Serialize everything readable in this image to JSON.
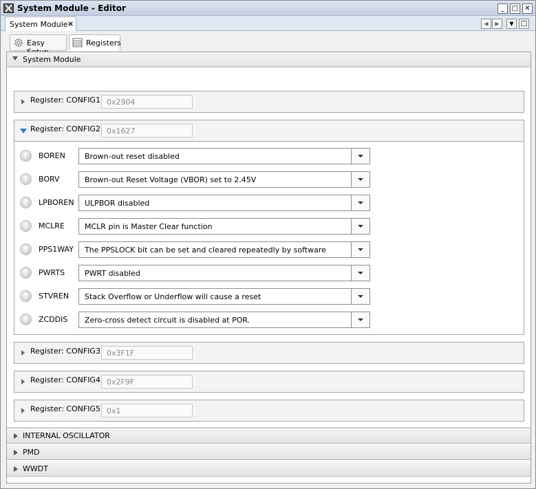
{
  "window": {
    "title": "System Module - Editor",
    "controls": {
      "minimize": "_",
      "maximize": "□",
      "close": "✕"
    }
  },
  "editor_tab": {
    "label": "System Module",
    "close": "×"
  },
  "nav": {
    "prev": "◀",
    "next": "▶",
    "menu": "▼",
    "restore": "□"
  },
  "subtabs": [
    {
      "label": "Easy Setup",
      "icon": "gear-icon",
      "active": false
    },
    {
      "label": "Registers",
      "icon": "list-icon",
      "active": true
    }
  ],
  "module_section": {
    "label": "System Module",
    "expanded": true
  },
  "registers": [
    {
      "label": "Register: CONFIG1",
      "value": "0x2904",
      "expanded": false
    },
    {
      "label": "Register: CONFIG2",
      "value": "0x1627",
      "expanded": true
    },
    {
      "label": "Register: CONFIG3",
      "value": "0x3F1F",
      "expanded": false
    },
    {
      "label": "Register: CONFIG4",
      "value": "0x2F9F",
      "expanded": false
    },
    {
      "label": "Register: CONFIG5",
      "value": "0x1",
      "expanded": false
    }
  ],
  "config2_settings": [
    {
      "name": "BOREN",
      "value": "Brown-out reset disabled"
    },
    {
      "name": "BORV",
      "value": "Brown-out Reset Voltage (VBOR) set to 2.45V"
    },
    {
      "name": "LPBOREN",
      "value": "ULPBOR disabled"
    },
    {
      "name": "MCLRE",
      "value": "MCLR pin is Master Clear function"
    },
    {
      "name": "PPS1WAY",
      "value": "The PPSLOCK bit can be set and cleared repeatedly by software"
    },
    {
      "name": "PWRTS",
      "value": "PWRT disabled"
    },
    {
      "name": "STVREN",
      "value": "Stack Overflow or Underflow will cause a reset"
    },
    {
      "name": "ZCDDIS",
      "value": "Zero-cross detect circuit is disabled at POR."
    }
  ],
  "collapsed_sections": [
    {
      "label": "INTERNAL OSCILLATOR"
    },
    {
      "label": "PMD"
    },
    {
      "label": "WWDT"
    }
  ],
  "help_glyph": "?"
}
